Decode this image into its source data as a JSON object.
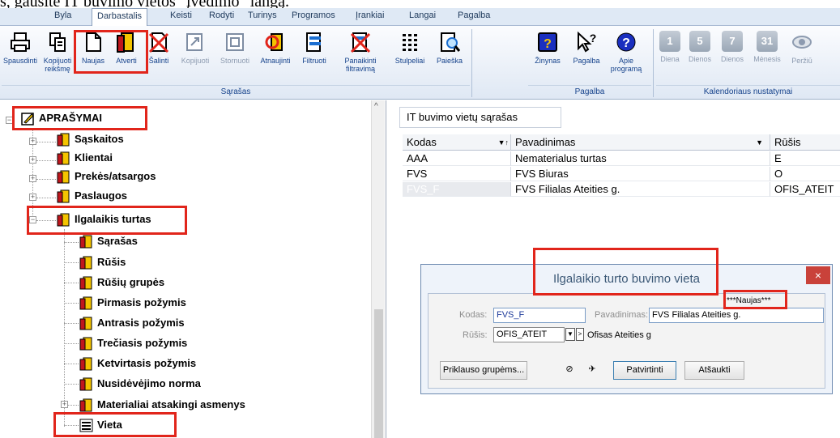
{
  "top_text": "s, gausite IT buvimo vietos \"įvedimo\" langą.",
  "menu": [
    "Byla",
    "Darbastalis",
    "Keisti",
    "Rodyti",
    "Turinys",
    "Programos",
    "Įrankiai",
    "Langai",
    "Pagalba"
  ],
  "ribbon": {
    "buttons": [
      {
        "label": "Spausdinti",
        "icon": "printer-icon"
      },
      {
        "label": "Kopijuoti reikšmę",
        "icon": "copy-icon"
      },
      {
        "label": "Naujas",
        "icon": "new-document-icon"
      },
      {
        "label": "Atverti",
        "icon": "open-book-icon"
      },
      {
        "label": "Šalinti",
        "icon": "delete-icon"
      },
      {
        "label": "Kopijuoti",
        "icon": "copy-doc-icon"
      },
      {
        "label": "Stornuoti",
        "icon": "storno-icon"
      },
      {
        "label": "Atnaujinti",
        "icon": "refresh-icon"
      },
      {
        "label": "Filtruoti",
        "icon": "filter-icon"
      },
      {
        "label": "Panaikinti filtravimą",
        "icon": "clear-filter-icon"
      },
      {
        "label": "Stulpeliai",
        "icon": "columns-icon"
      },
      {
        "label": "Paieška",
        "icon": "search-icon"
      },
      {
        "label": "Žinynas",
        "icon": "help-book-icon"
      },
      {
        "label": "Pagalba",
        "icon": "help-pointer-icon"
      },
      {
        "label": "Apie programą",
        "icon": "about-icon"
      },
      {
        "label": "Diena",
        "icon": "calendar-1-icon",
        "num": "1"
      },
      {
        "label": "Dienos",
        "icon": "calendar-5-icon",
        "num": "5"
      },
      {
        "label": "Dienos",
        "icon": "calendar-7-icon",
        "num": "7"
      },
      {
        "label": "Mėnesis",
        "icon": "calendar-31-icon",
        "num": "31"
      },
      {
        "label": "Peržiū",
        "icon": "eye-icon"
      }
    ],
    "groups": [
      "Sąrašas",
      "Pagalba",
      "Kalendoriaus nustatymai"
    ]
  },
  "tree": {
    "root": "APRAŠYMAI",
    "items": [
      "Sąskaitos",
      "Klientai",
      "Prekės/atsargos",
      "Paslaugos",
      "Ilgalaikis turtas"
    ],
    "children": [
      "Sąrašas",
      "Rūšis",
      "Rūšių grupės",
      "Pirmasis požymis",
      "Antrasis požymis",
      "Trečiasis požymis",
      "Ketvirtasis požymis",
      "Nusidėvėjimo norma",
      "Materialiai atsakingi asmenys",
      "Vieta"
    ]
  },
  "list": {
    "tab": "IT buvimo vietų sąrašas",
    "columns": [
      "Kodas",
      "Pavadinimas",
      "Rūšis"
    ],
    "rows": [
      [
        "AAA",
        "Nematerialus turtas",
        "E"
      ],
      [
        "FVS",
        "FVS Biuras",
        "O"
      ],
      [
        "FVS_F",
        "FVS Filialas Ateities g.",
        "OFIS_ATEIT"
      ]
    ]
  },
  "dialog": {
    "title": "Ilgalaikio turto buvimo vieta",
    "state": "***Naujas***",
    "kodas_label": "Kodas:",
    "kodas_value": "FVS_F",
    "pavadinimas_label": "Pavadinimas:",
    "pavadinimas_value": "FVS Filialas Ateities g.",
    "rusis_label": "Rūšis:",
    "rusis_value": "OFIS_ATEIT",
    "rusis_desc": "Ofisas Ateities g",
    "btn_groups": "Priklauso grupėms...",
    "btn_confirm": "Patvirtinti",
    "btn_cancel": "Atšaukti",
    "close": "×"
  },
  "colors": {
    "highlight_red": "#e1251b",
    "book_red": "#c0161c",
    "book_yellow": "#f4c400"
  }
}
